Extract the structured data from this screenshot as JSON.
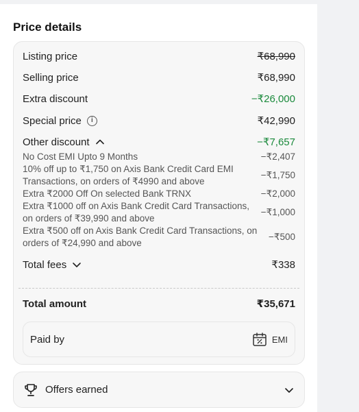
{
  "title": "Price details",
  "rows": {
    "listing": {
      "label": "Listing price",
      "value": "₹68,990"
    },
    "selling": {
      "label": "Selling price",
      "value": "₹68,990"
    },
    "extra": {
      "label": "Extra discount",
      "value": "−₹26,000"
    },
    "special": {
      "label": "Special price",
      "value": "₹42,990"
    },
    "other": {
      "label": "Other discount",
      "value": "−₹7,657"
    },
    "fees": {
      "label": "Total fees",
      "value": "₹338"
    },
    "total": {
      "label": "Total amount",
      "value": "₹35,671"
    }
  },
  "discounts": [
    {
      "text": "No Cost EMI Upto 9 Months",
      "amount": "−₹2,407"
    },
    {
      "text": "10% off up to ₹1,750 on Axis Bank Credit Card EMI Transactions, on orders of ₹4990 and above",
      "amount": "−₹1,750"
    },
    {
      "text": "Extra ₹2000 Off On selected Bank TRNX",
      "amount": "−₹2,000"
    },
    {
      "text": "Extra ₹1000 off on Axis Bank Credit Card Transactions, on orders of ₹39,990 and above",
      "amount": "−₹1,000"
    },
    {
      "text": "Extra ₹500 off on Axis Bank Credit Card Transactions, on orders of ₹24,990 and above",
      "amount": "−₹500"
    }
  ],
  "paid_by": {
    "label": "Paid by",
    "method": "EMI"
  },
  "offers": {
    "label": "Offers earned"
  },
  "colors": {
    "discount_green": "#1b8a3c"
  },
  "icons": {
    "info": "info-icon",
    "other_toggle": "chevron-up-icon",
    "fees_toggle": "chevron-down-icon",
    "emi": "calendar-percent-icon",
    "offers": "trophy-icon",
    "offers_toggle": "chevron-down-icon"
  }
}
